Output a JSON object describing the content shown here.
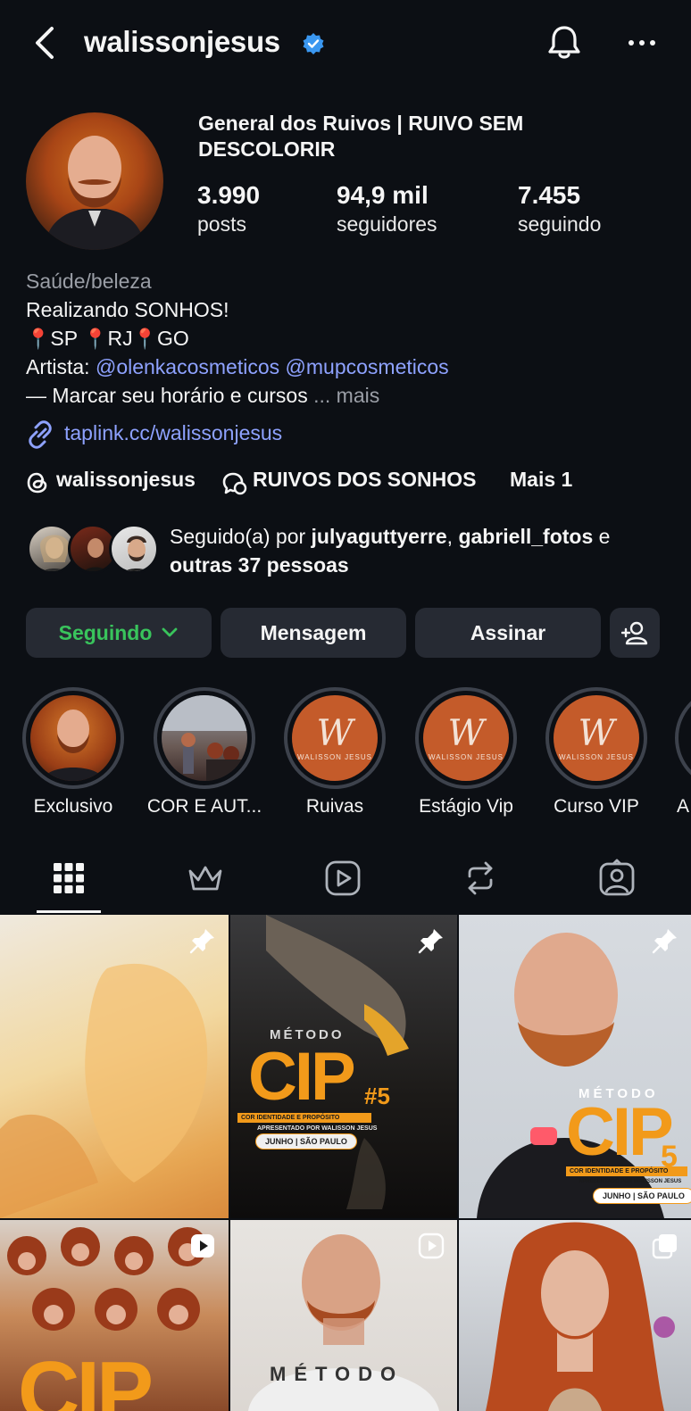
{
  "header": {
    "username": "walissonjesus",
    "icons": {
      "back": "chevron-left-icon",
      "verified": "verified-badge-icon",
      "notifications": "bell-icon",
      "more": "more-horizontal-icon"
    }
  },
  "profile": {
    "display_name": "General dos Ruivos | RUIVO SEM DESCOLORIR",
    "stats": [
      {
        "value": "3.990",
        "label": "posts"
      },
      {
        "value": "94,9 mil",
        "label": "seguidores"
      },
      {
        "value": "7.455",
        "label": "seguindo"
      }
    ],
    "category": "Saúde/beleza",
    "bio_line1": "Realizando SONHOS!",
    "bio_locations": [
      "SP",
      "RJ",
      "GO"
    ],
    "bio_artist_label": "Artista:",
    "bio_mentions": [
      "@olenkacosmeticos",
      "@mupcosmeticos"
    ],
    "bio_line4": "— Marcar seu horário e cursos",
    "bio_more": "... mais",
    "link": "taplink.cc/walissonjesus",
    "threads_handle": "walissonjesus",
    "community": "RUIVOS DOS SONHOS",
    "more_links": "Mais 1"
  },
  "followed_by": {
    "prefix": "Seguido(a) por",
    "names": [
      "julyaguttyerre",
      "gabriell_fotos"
    ],
    "joiner": "e",
    "others": "outras 37 pessoas"
  },
  "actions": {
    "following": "Seguindo",
    "message": "Mensagem",
    "subscribe": "Assinar"
  },
  "highlights": [
    {
      "label": "Exclusivo"
    },
    {
      "label": "COR E AUT..."
    },
    {
      "label": "Ruivas"
    },
    {
      "label": "Estágio Vip"
    },
    {
      "label": "Curso VIP"
    },
    {
      "label": "A"
    }
  ],
  "highlight_brand": {
    "mark": "W",
    "text": "WALISSON JESUS"
  },
  "tabs": [
    "grid-icon",
    "crown-icon",
    "reels-icon",
    "reposts-icon",
    "tagged-icon"
  ],
  "posts": {
    "cip_small": "MÉTODO",
    "cip_big": "CIP",
    "cip_num5": "#5",
    "cip_num": "5",
    "cip_sub": "COR IDENTIDADE E PROPÓSITO",
    "cip_by": "APRESENTADO POR WALISSON JESUS",
    "cip_date": "JUNHO | SÃO PAULO",
    "cip_bottom": "MÉTODO"
  },
  "colors": {
    "background": "#0c0f14",
    "button": "#262a33",
    "link": "#8ea2ff",
    "following": "#39c45c",
    "verified": "#3a97f0"
  }
}
